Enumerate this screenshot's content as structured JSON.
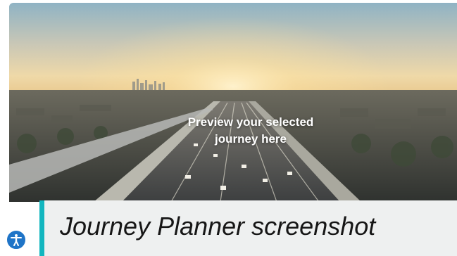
{
  "hero": {
    "image": "aerial-highway-at-sunrise",
    "caption_line1": "Preview your selected",
    "caption_line2": "journey here"
  },
  "caption_bar": {
    "title": "Journey Planner screenshot",
    "accent_color": "#12b6bf"
  },
  "accessibility_widget": {
    "icon": "accessibility-icon",
    "color": "#1f74c7"
  }
}
